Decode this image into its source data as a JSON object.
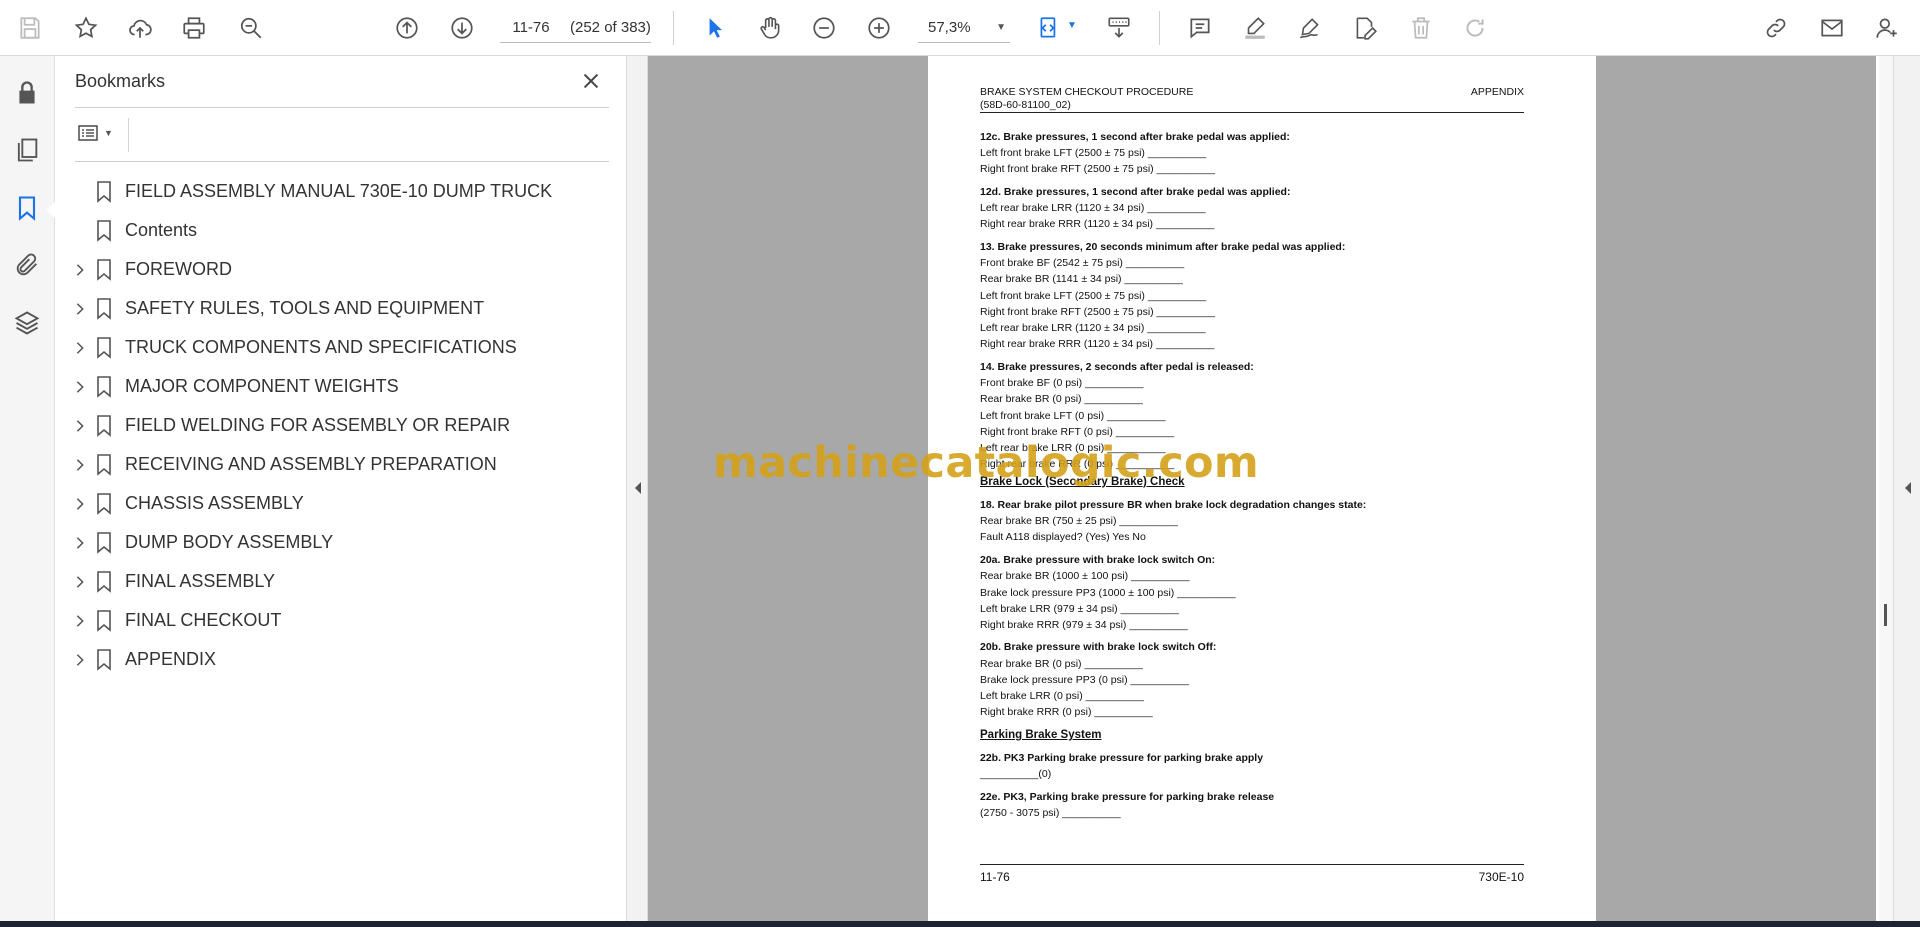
{
  "toolbar": {
    "page_current": "11-76",
    "page_count": "(252 of 383)",
    "zoom": "57,3%",
    "icons": [
      "save-icon",
      "star-icon",
      "upload-icon",
      "print-icon",
      "zoom-search-icon",
      "arrow-up-icon",
      "arrow-down-icon",
      "select-arrow-icon",
      "hand-icon",
      "zoom-out-icon",
      "zoom-in-icon",
      "fit-page-icon",
      "keyboard-scroll-icon",
      "comment-icon",
      "highlight-icon",
      "sign-icon",
      "edit-doc-icon",
      "delete-icon",
      "redo-icon",
      "link-cloud-icon",
      "mail-icon",
      "user-add-icon"
    ]
  },
  "rail": {
    "icons": [
      "lock-icon",
      "pages-icon",
      "bookmark-icon",
      "attachment-icon",
      "layers-icon"
    ]
  },
  "bookmarks": {
    "title": "Bookmarks",
    "items": [
      {
        "label": "FIELD ASSEMBLY MANUAL 730E-10  DUMP TRUCK",
        "expandable": false
      },
      {
        "label": "Contents",
        "expandable": false
      },
      {
        "label": "FOREWORD",
        "expandable": true
      },
      {
        "label": "SAFETY RULES, TOOLS AND EQUIPMENT",
        "expandable": true
      },
      {
        "label": "TRUCK COMPONENTS AND SPECIFICATIONS",
        "expandable": true
      },
      {
        "label": "MAJOR COMPONENT WEIGHTS",
        "expandable": true
      },
      {
        "label": "FIELD WELDING FOR ASSEMBLY OR REPAIR",
        "expandable": true
      },
      {
        "label": "RECEIVING AND ASSEMBLY PREPARATION",
        "expandable": true
      },
      {
        "label": "CHASSIS ASSEMBLY",
        "expandable": true
      },
      {
        "label": "DUMP BODY ASSEMBLY",
        "expandable": true
      },
      {
        "label": "FINAL ASSEMBLY",
        "expandable": true
      },
      {
        "label": "FINAL CHECKOUT",
        "expandable": true
      },
      {
        "label": "APPENDIX",
        "expandable": true
      }
    ]
  },
  "document": {
    "header_left_1": "BRAKE SYSTEM CHECKOUT PROCEDURE",
    "header_left_2": "(58D-60-81100_02)",
    "header_right": "APPENDIX",
    "lines": [
      {
        "text": "12c. Brake pressures, 1 second after brake pedal was applied:",
        "style": "bold"
      },
      {
        "text": "Left front brake LFT (2500 ± 75 psi) __________",
        "style": "normal"
      },
      {
        "text": "Right front brake RFT (2500 ± 75 psi) __________",
        "style": "normal"
      },
      {
        "text": "12d. Brake pressures, 1 second after brake pedal was applied:",
        "style": "bold"
      },
      {
        "text": "Left rear brake LRR (1120 ± 34 psi) __________",
        "style": "normal"
      },
      {
        "text": "Right rear brake RRR (1120 ± 34 psi) __________",
        "style": "normal"
      },
      {
        "text": "13. Brake pressures, 20 seconds minimum after brake pedal was applied:",
        "style": "bold"
      },
      {
        "text": "Front brake BF (2542 ± 75 psi) __________",
        "style": "normal"
      },
      {
        "text": "Rear brake BR (1141 ± 34 psi) __________",
        "style": "normal"
      },
      {
        "text": "Left front brake LFT (2500 ± 75 psi) __________",
        "style": "normal"
      },
      {
        "text": "Right front brake RFT (2500 ± 75 psi) __________",
        "style": "normal"
      },
      {
        "text": "Left rear brake LRR (1120 ± 34 psi) __________",
        "style": "normal"
      },
      {
        "text": "Right rear brake RRR (1120 ± 34 psi) __________",
        "style": "normal"
      },
      {
        "text": "14. Brake pressures, 2 seconds after pedal is released:",
        "style": "bold"
      },
      {
        "text": "Front brake BF (0 psi) __________",
        "style": "normal"
      },
      {
        "text": "Rear brake BR (0 psi) __________",
        "style": "normal"
      },
      {
        "text": "Left front brake LFT (0 psi) __________",
        "style": "normal"
      },
      {
        "text": "Right front brake RFT (0 psi) __________",
        "style": "normal"
      },
      {
        "text": "Left rear brake LRR (0 psi) __________",
        "style": "normal"
      },
      {
        "text": "Right rear brake RRR (0 psi) __________",
        "style": "normal"
      },
      {
        "text": "Brake Lock (Secondary Brake) Check",
        "style": "underline"
      },
      {
        "text": "18. Rear brake pilot pressure BR when brake lock degradation changes state:",
        "style": "bold"
      },
      {
        "text": "Rear brake BR (750 ± 25 psi) __________",
        "style": "normal"
      },
      {
        "text": "Fault A118 displayed? (Yes) Yes No",
        "style": "normal"
      },
      {
        "text": "20a. Brake pressure with brake lock switch On:",
        "style": "bold"
      },
      {
        "text": "Rear brake BR (1000 ± 100 psi) __________",
        "style": "normal"
      },
      {
        "text": "Brake lock pressure PP3 (1000 ± 100 psi) __________",
        "style": "normal"
      },
      {
        "text": "Left brake LRR (979 ± 34 psi) __________",
        "style": "normal"
      },
      {
        "text": "Right brake RRR (979 ± 34 psi) __________",
        "style": "normal"
      },
      {
        "text": "20b. Brake pressure with brake lock switch Off:",
        "style": "bold"
      },
      {
        "text": "Rear brake BR (0 psi) __________",
        "style": "normal"
      },
      {
        "text": "Brake lock pressure PP3 (0 psi) __________",
        "style": "normal"
      },
      {
        "text": "Left brake LRR (0 psi) __________",
        "style": "normal"
      },
      {
        "text": "Right brake RRR (0 psi) __________",
        "style": "normal"
      },
      {
        "text": "Parking Brake System",
        "style": "underline"
      },
      {
        "text": "22b. PK3 Parking brake pressure for parking brake apply",
        "style": "bold"
      },
      {
        "text": "__________(0)",
        "style": "normal"
      },
      {
        "text": "22e. PK3, Parking brake pressure for parking brake release",
        "style": "bold"
      },
      {
        "text": "(2750 - 3075 psi) __________",
        "style": "normal"
      }
    ],
    "footer_left": "11-76",
    "footer_right": "730E-10"
  },
  "watermark": "machinecatalogic.com",
  "colors": {
    "accent": "#1a73e8",
    "watermark": "#d4a21a",
    "doc_bg": "#a8a8a8"
  }
}
